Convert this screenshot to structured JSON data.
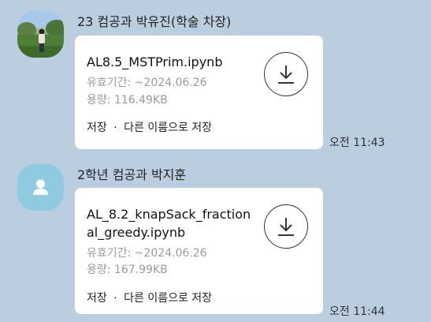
{
  "messages": [
    {
      "sender": "23 컴공과 박유진(학술 차장)",
      "avatar_icon": "profile-photo",
      "file": {
        "name": "AL8.5_MSTPrim.ipynb",
        "expiry": "유효기간: ~2024.06.26",
        "size": "용량: 116.49KB",
        "save_label": "저장",
        "separator": "·",
        "save_as_label": "다른 이름으로 저장",
        "download_icon": "download-icon"
      },
      "time": "오전 11:43"
    },
    {
      "sender": "2학년 컴공과 박지훈",
      "avatar_icon": "default-user-icon",
      "file": {
        "name": "AL_8.2_knapSack_fractional_greedy.ipynb",
        "expiry": "유효기간: ~2024.06.26",
        "size": "용량: 167.99KB",
        "save_label": "저장",
        "separator": "·",
        "save_as_label": "다른 이름으로 저장",
        "download_icon": "download-icon"
      },
      "time": "오전 11:44"
    }
  ],
  "colors": {
    "background": "#bacee0",
    "bubble": "#ffffff",
    "meta_text": "#9a9a9a",
    "default_avatar": "#8fcbe0"
  }
}
